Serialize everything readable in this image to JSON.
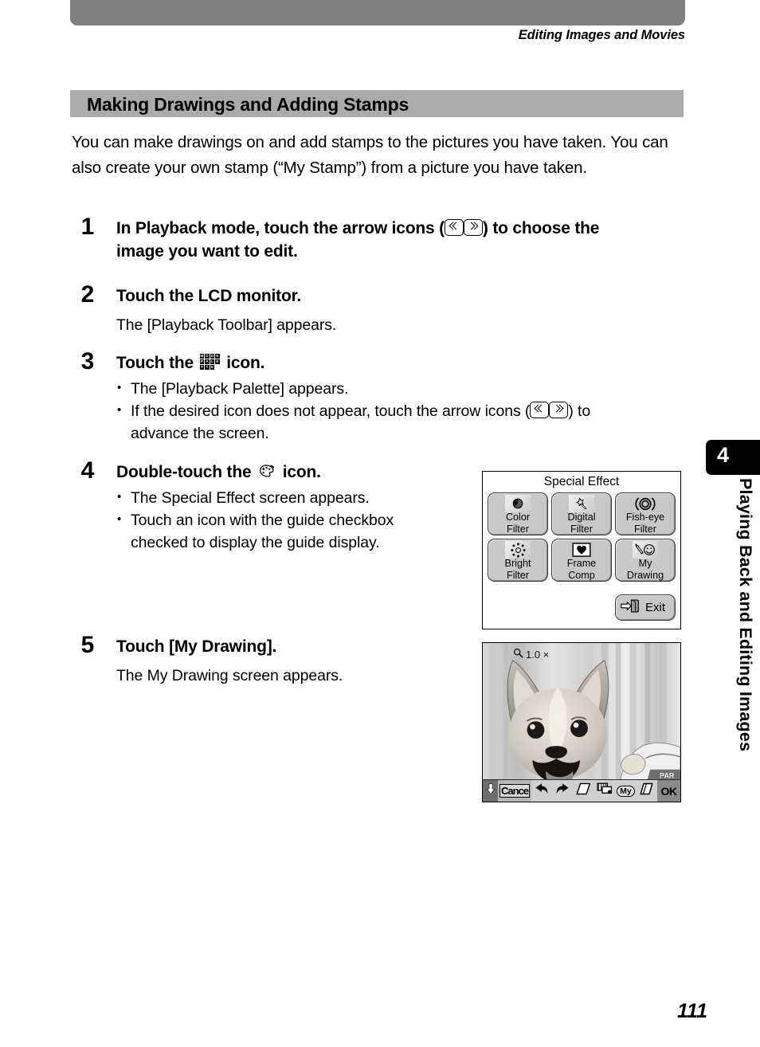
{
  "header": {
    "running_head": "Editing Images and Movies"
  },
  "section": {
    "title": "Making Drawings and Adding Stamps"
  },
  "intro": "You can make drawings on and add stamps to the pictures you have taken. You can also create your own stamp (“My Stamp”) from a picture you have taken.",
  "steps": [
    {
      "num": "1",
      "head_pre": "In Playback mode, touch the arrow icons (",
      "head_post": ") to choose the image you want to edit."
    },
    {
      "num": "2",
      "head": "Touch the LCD monitor.",
      "sub": "The [Playback Toolbar] appears."
    },
    {
      "num": "3",
      "head_pre": "Touch the ",
      "head_post": " icon.",
      "bullet1": "The [Playback Palette] appears.",
      "bullet2_pre": "If the desired icon does not appear, touch the arrow icons (",
      "bullet2_post": ") to advance the screen."
    },
    {
      "num": "4",
      "head_pre": "Double-touch the ",
      "head_post": " icon.",
      "bullet1": "The Special Effect screen appears.",
      "bullet2": "Touch an icon with the guide checkbox checked to display the guide display."
    },
    {
      "num": "5",
      "head": "Touch [My Drawing].",
      "sub": "The My Drawing screen appears."
    }
  ],
  "mode_palette_icon": {
    "name": "mode-palette-icon",
    "letters": [
      "M",
      "O",
      "D",
      "E",
      "P",
      "A",
      "L",
      "E",
      "T",
      "T",
      "E"
    ]
  },
  "special_effect_screen": {
    "title": "Special Effect",
    "buttons": [
      {
        "label_line1": "Color",
        "label_line2": "Filter",
        "icon": "color-filter-icon"
      },
      {
        "label_line1": "Digital",
        "label_line2": "Filter",
        "icon": "digital-filter-icon"
      },
      {
        "label_line1": "Fish-eye",
        "label_line2": "Filter",
        "icon": "fisheye-filter-icon"
      },
      {
        "label_line1": "Bright",
        "label_line2": "Filter",
        "icon": "bright-filter-icon"
      },
      {
        "label_line1": "Frame",
        "label_line2": "Comp",
        "icon": "frame-comp-icon"
      },
      {
        "label_line1": "My",
        "label_line2": "Drawing",
        "icon": "my-drawing-icon"
      }
    ],
    "exit_label": "Exit",
    "exit_icon": "exit-arrow-icon"
  },
  "my_drawing_screen": {
    "zoom_label": "1.0 ×",
    "zoom_icon": "magnifier-icon",
    "toolbar": {
      "down_icon": "down-arrow-icon",
      "cancel_label": "Cance",
      "undo_icon": "undo-arrow-icon",
      "redo_icon": "redo-arrow-icon",
      "pen_icon": "pen-nib-icon",
      "stamp_icon": "frame-stamp-icon",
      "my_label": "My",
      "eraser_icon": "eraser-icon",
      "ok_label": "OK"
    }
  },
  "chapter_tab": {
    "number": "4",
    "text": "Playing Back and Editing Images"
  },
  "page_number": "111",
  "colors": {
    "top_bar": "#808080",
    "section_bar": "#ababab",
    "tab_black": "#000000",
    "button_face": "#c8c8c8"
  }
}
